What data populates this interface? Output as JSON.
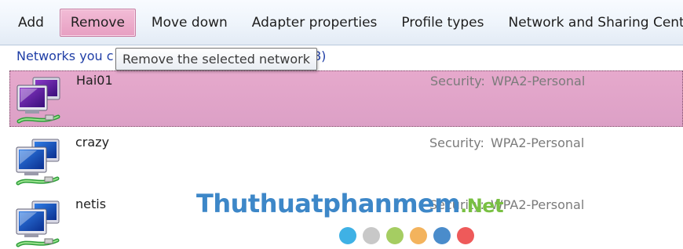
{
  "toolbar": {
    "add": "Add",
    "remove": "Remove",
    "move_down": "Move down",
    "adapter_properties": "Adapter properties",
    "profile_types": "Profile types",
    "network_sharing": "Network and Sharing Center"
  },
  "section": {
    "header_visible": "Networks you c",
    "header_tail": "8)"
  },
  "tooltip": {
    "text": "Remove the selected network"
  },
  "networks": [
    {
      "name": "Hai01",
      "security_label": "Security:",
      "security_value": "WPA2-Personal",
      "selected": true,
      "icon": "wireless-network-computers-icon"
    },
    {
      "name": "crazy",
      "security_label": "Security:",
      "security_value": "WPA2-Personal",
      "selected": false,
      "icon": "wireless-network-computers-icon"
    },
    {
      "name": "netis",
      "security_label": "Security:",
      "security_value": "WPA2-Personal",
      "selected": false,
      "icon": "wireless-network-computers-icon"
    }
  ],
  "watermark": {
    "main": "Thuthuatphanmem",
    "suffix": ".Net",
    "dot_colors": [
      "#3fb1e5",
      "#c8c8c8",
      "#a5cd62",
      "#f3b35d",
      "#4a8ccb",
      "#ee5a5a"
    ]
  },
  "colors": {
    "hover_button": "#e79fc2",
    "selected_row": "#e2a6ca",
    "link_blue": "#1f3ea6",
    "security_gray": "#7b7b7b"
  }
}
